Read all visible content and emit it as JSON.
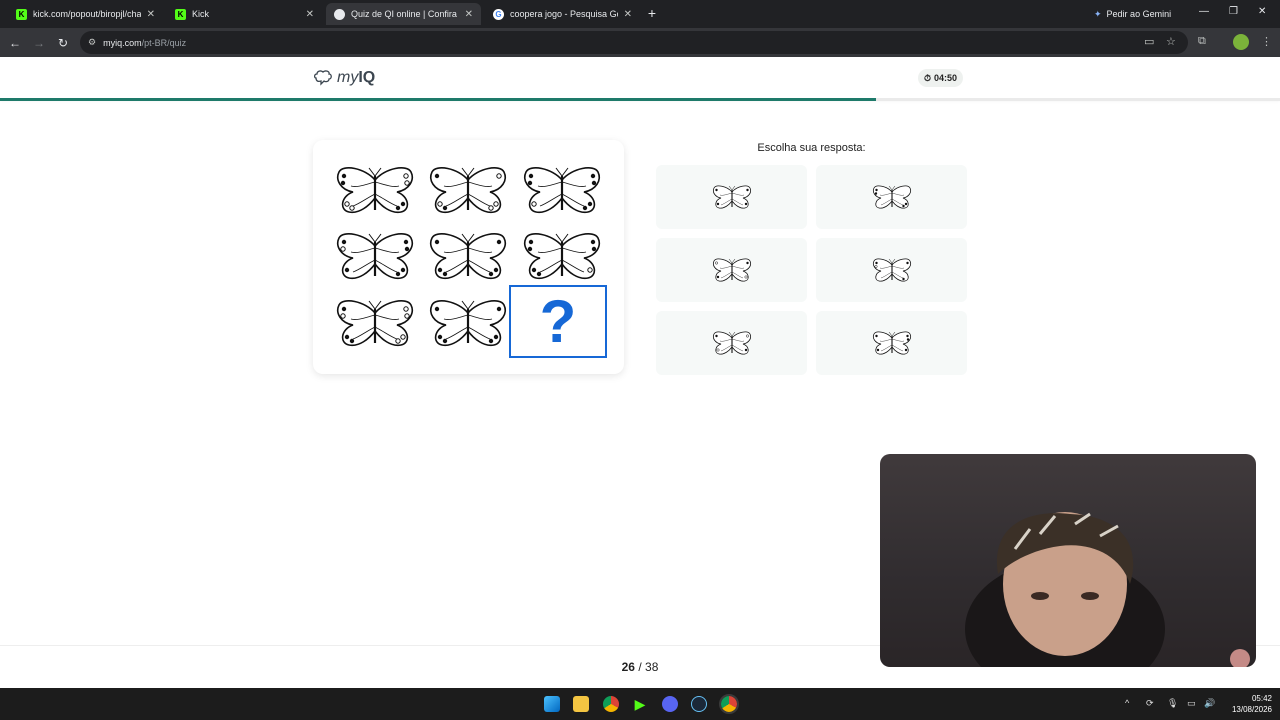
{
  "browser": {
    "tabs": [
      {
        "title": "kick.com/popout/biropjl/chat",
        "active": false,
        "favicon": "kick-icon"
      },
      {
        "title": "Kick",
        "active": false,
        "favicon": "kick-icon"
      },
      {
        "title": "Quiz de QI online | Confira sua",
        "active": true,
        "favicon": "myiq-icon"
      },
      {
        "title": "coopera jogo - Pesquisa Google",
        "active": false,
        "favicon": "google-icon"
      }
    ],
    "gemini_label": "Pedir ao Gemini",
    "url_host": "myiq.com",
    "url_path": "/pt-BR/quiz"
  },
  "header": {
    "brand_prefix": "my",
    "brand_suffix": "IQ",
    "timer": "04:50",
    "progress_percent": 68.4
  },
  "answers": {
    "title": "Escolha sua resposta:"
  },
  "pagination": {
    "current": "26",
    "separator": "/",
    "total": "38"
  },
  "taskbar": {
    "time": "05:42",
    "date": "13/08/2026"
  },
  "colors": {
    "accent": "#1e7a6a",
    "question": "#1668d6",
    "option_bg": "#f6f9f8"
  }
}
